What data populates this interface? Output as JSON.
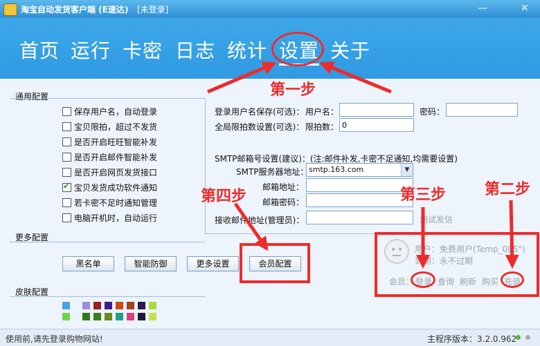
{
  "window": {
    "title": "淘宝自动发货客户端 (E速达)",
    "status": "[未登录]",
    "minimize_label": "—",
    "close_label": "✕",
    "icon": "app-icon"
  },
  "nav": {
    "items": [
      "首页",
      "运行",
      "卡密",
      "日志",
      "统计",
      "设置",
      "关于"
    ],
    "active": "设置"
  },
  "sections": {
    "general": "通用配置",
    "more": "更多配置",
    "skin": "皮肤配置"
  },
  "checkboxes": [
    {
      "label": "保存用户名，自动登录",
      "checked": false
    },
    {
      "label": "宝贝限拍，超过不发货",
      "checked": false
    },
    {
      "label": "是否开启旺旺智能补发",
      "checked": false
    },
    {
      "label": "是否开启邮件智能补发",
      "checked": false
    },
    {
      "label": "是否开启网页发货接口",
      "checked": false
    },
    {
      "label": "宝贝发货成功软件通知",
      "checked": true
    },
    {
      "label": "若卡密不足时通知管理",
      "checked": false
    },
    {
      "label": "电脑开机时，自动运行",
      "checked": false
    }
  ],
  "login": {
    "save_label": "登录用户名保存(可选)：",
    "username_label": "用户名：",
    "username_value": "",
    "password_label": "密码：",
    "password_value": "",
    "limit_label": "全局限拍数设置(可选)：",
    "limit_count_label": "限拍数：",
    "limit_value": "0"
  },
  "smtp": {
    "header": "SMTP邮箱号设置(建议)：(注:邮件补发,卡密不足通知,均需要设置)",
    "server_label": "SMTP服务器地址：",
    "server_value": "smtp.163.com",
    "email_label": "邮箱地址：",
    "email_value": "",
    "email_pw_label": "邮箱密码：",
    "email_pw_value": "",
    "receiver_label": "接收邮件地址(管理员)：",
    "receiver_value": "",
    "test_label": "测试发信"
  },
  "more_buttons": [
    "黑名单",
    "智能防御",
    "更多设置",
    "会员配置"
  ],
  "skin_colors": [
    "#4ba3e0",
    "#9b8de0",
    "#9b1f2a",
    "#3a1f8a",
    "#c94a15",
    "#a43f1f",
    "#2c1a4e",
    "#a9dc3a",
    "#6fd44a",
    "#2f7a1e",
    "#3e7d1a",
    "#6a8a1d",
    "#1fa08a",
    "#e03a80",
    "#1d1a3d",
    "#c9e04a"
  ],
  "member": {
    "user_label": "用户：免费用户(Temp_085",
    "user_suffix": "\")",
    "expire_label": "到期：永不过期",
    "member_label": "会员：",
    "login_link": "登录",
    "query_link": "查询",
    "refresh_link": "刷新",
    "buy_link": "购买",
    "recharge_link": "充值"
  },
  "annotations": {
    "step1": "第一步",
    "step2": "第二步",
    "step3": "第三步",
    "step4": "第四步",
    "color": "#ee2b2b"
  },
  "statusbar": {
    "message": "使用前,请先登录购物网站!",
    "version": "主程序版本：3.2.0.962"
  }
}
